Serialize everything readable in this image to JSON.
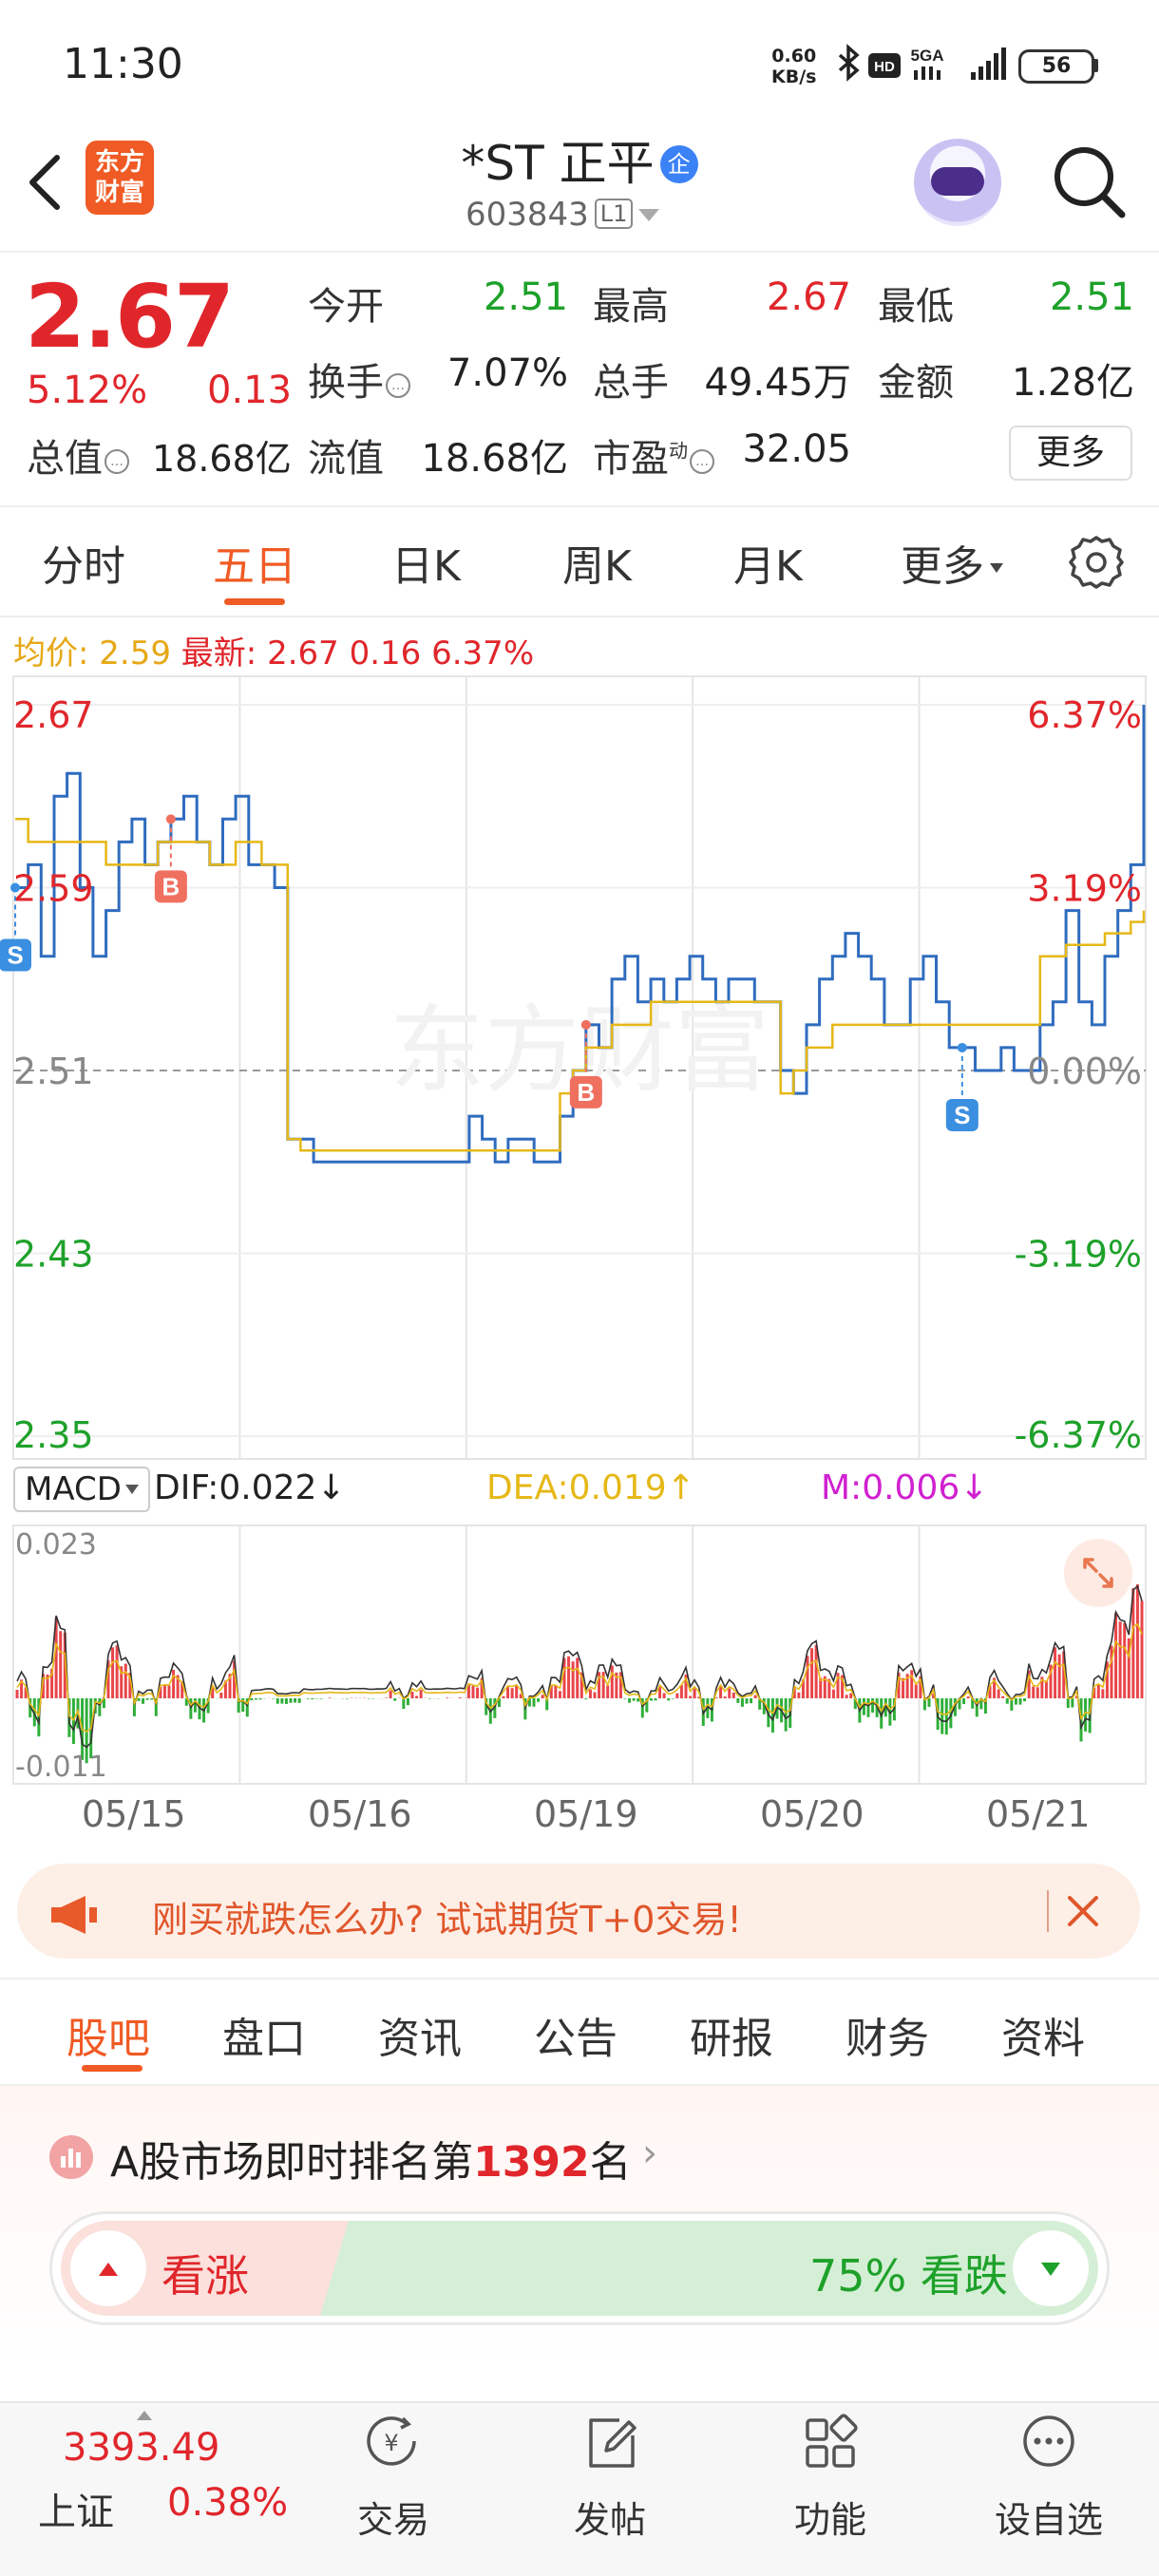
{
  "status_bar": {
    "time": "11:30",
    "net_speed": "0.60",
    "net_unit": "KB/s",
    "network": "5GA",
    "battery": "56",
    "icons": [
      "bluetooth-icon",
      "hd-icon",
      "signal-icon",
      "battery-icon"
    ]
  },
  "header": {
    "title": "*ST 正平",
    "title_badge": "企",
    "code": "603843",
    "level": "L1",
    "logo_line1": "东方",
    "logo_line2": "财富"
  },
  "quote": {
    "price": "2.67",
    "change_pct": "5.12%",
    "change": "0.13",
    "open_label": "今开",
    "open": "2.51",
    "high_label": "最高",
    "high": "2.67",
    "low_label": "最低",
    "low": "2.51",
    "turnover_label": "换手",
    "turnover": "7.07%",
    "volume_label": "总手",
    "volume": "49.45万",
    "amount_label": "金额",
    "amount": "1.28亿",
    "mktcap_label": "总值",
    "mktcap": "18.68亿",
    "float_label": "流值",
    "float": "18.68亿",
    "pe_label": "市盈",
    "pe_sup": "动",
    "pe": "32.05",
    "more": "更多"
  },
  "tabs": [
    {
      "label": "分时"
    },
    {
      "label": "五日",
      "active": true
    },
    {
      "label": "日K"
    },
    {
      "label": "周K"
    },
    {
      "label": "月K"
    },
    {
      "label": "更多"
    }
  ],
  "legend": {
    "avg_label": "均价:",
    "avg_value": "2.59",
    "latest_label": "最新:",
    "latest_value": "2.67",
    "latest_change": "0.16",
    "latest_pct": "6.37%"
  },
  "chart_data": {
    "type": "line",
    "y_ticks_left": [
      "2.67",
      "2.59",
      "2.51",
      "2.43",
      "2.35"
    ],
    "y_ticks_right": [
      "6.37%",
      "3.19%",
      "0.00%",
      "-3.19%",
      "-6.37%"
    ],
    "ylim": [
      2.35,
      2.67
    ],
    "baseline": 2.51,
    "x_dates": [
      "05/15",
      "05/16",
      "05/19",
      "05/20",
      "05/21"
    ],
    "series": [
      {
        "color": "#2f6cbf",
        "values": [
          2.59,
          2.6,
          2.56,
          2.63,
          2.64,
          2.59,
          2.56,
          2.58,
          2.61,
          2.62,
          2.6,
          2.61,
          2.62,
          2.63,
          2.61,
          2.6,
          2.62,
          2.63,
          2.6,
          2.6,
          2.59,
          2.48,
          2.48,
          2.47,
          2.47,
          2.47,
          2.47,
          2.47,
          2.47,
          2.47,
          2.47,
          2.47,
          2.47,
          2.47,
          2.47,
          2.49,
          2.48,
          2.47,
          2.48,
          2.48,
          2.47,
          2.47,
          2.49,
          2.51,
          2.53,
          2.52,
          2.55,
          2.56,
          2.54,
          2.55,
          2.54,
          2.55,
          2.56,
          2.55,
          2.54,
          2.55,
          2.55,
          2.54,
          2.54,
          2.51,
          2.5,
          2.53,
          2.55,
          2.56,
          2.57,
          2.56,
          2.55,
          2.53,
          2.53,
          2.55,
          2.56,
          2.54,
          2.52,
          2.52,
          2.51,
          2.51,
          2.52,
          2.51,
          2.51,
          2.53,
          2.54,
          2.58,
          2.54,
          2.53,
          2.56,
          2.58,
          2.6,
          2.67
        ]
      },
      {
        "name": "均价",
        "color": "#e6b817",
        "values": [
          2.62,
          2.61,
          2.61,
          2.61,
          2.61,
          2.61,
          2.61,
          2.6,
          2.6,
          2.6,
          2.6,
          2.61,
          2.61,
          2.61,
          2.61,
          2.6,
          2.6,
          2.61,
          2.61,
          2.6,
          2.6,
          2.48,
          2.475,
          2.475,
          2.475,
          2.475,
          2.475,
          2.475,
          2.475,
          2.475,
          2.475,
          2.475,
          2.475,
          2.475,
          2.475,
          2.475,
          2.475,
          2.475,
          2.475,
          2.475,
          2.475,
          2.475,
          2.5,
          2.51,
          2.52,
          2.52,
          2.53,
          2.53,
          2.53,
          2.54,
          2.54,
          2.54,
          2.54,
          2.54,
          2.54,
          2.54,
          2.54,
          2.54,
          2.54,
          2.5,
          2.51,
          2.52,
          2.52,
          2.53,
          2.53,
          2.53,
          2.53,
          2.53,
          2.53,
          2.53,
          2.53,
          2.53,
          2.53,
          2.53,
          2.53,
          2.53,
          2.53,
          2.53,
          2.53,
          2.56,
          2.56,
          2.565,
          2.565,
          2.565,
          2.57,
          2.57,
          2.575,
          2.58
        ]
      }
    ],
    "markers": [
      "S",
      "B",
      "B",
      "S"
    ]
  },
  "macd": {
    "selector": "MACD",
    "dif": "DIF:0.022",
    "dea": "DEA:0.019",
    "m": "M:0.006",
    "ytop": "0.023",
    "ybottom": "-0.011"
  },
  "banner": {
    "text": "刚买就跌怎么办? 试试期货T+0交易!"
  },
  "bottom_tabs": [
    {
      "label": "股吧",
      "active": true
    },
    {
      "label": "盘口"
    },
    {
      "label": "资讯"
    },
    {
      "label": "公告"
    },
    {
      "label": "研报"
    },
    {
      "label": "财务"
    },
    {
      "label": "资料"
    }
  ],
  "ranking": {
    "prefix": "A股市场即时排名第",
    "rank": "1392",
    "suffix": "名",
    "up_label": "看涨",
    "down_label": "75% 看跌",
    "down_fraction": 0.75
  },
  "bottom_nav": {
    "index_value": "3393.49",
    "index_name": "上证",
    "index_pct": "0.38%",
    "items": [
      {
        "label": "交易",
        "icon": "trade-icon"
      },
      {
        "label": "发帖",
        "icon": "post-icon"
      },
      {
        "label": "功能",
        "icon": "apps-icon"
      },
      {
        "label": "设自选",
        "icon": "watchlist-icon"
      }
    ]
  }
}
